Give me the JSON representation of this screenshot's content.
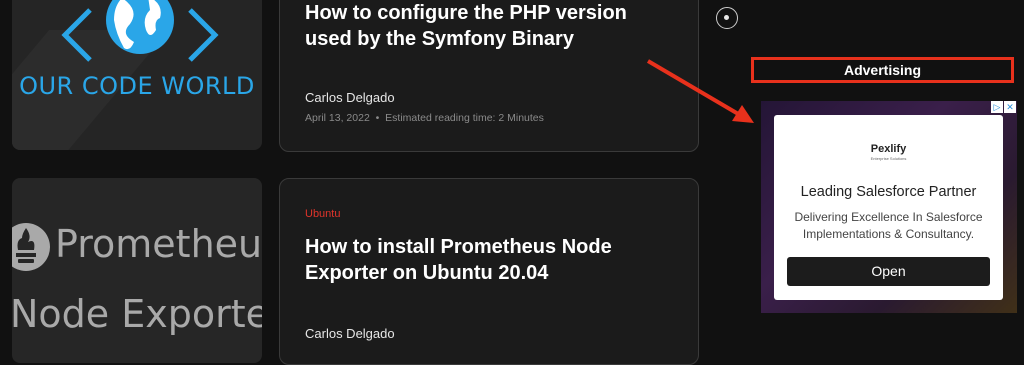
{
  "articles": [
    {
      "logo_text": "OUR CODE WORLD",
      "title_line1": "How to configure the PHP version",
      "title_line2": "used by the Symfony Binary",
      "author": "Carlos Delgado",
      "date": "April 13, 2022",
      "reading_time": "Estimated reading time: 2 Minutes"
    },
    {
      "thumb_line1": "Prometheus",
      "thumb_line2": "Node Exporter",
      "category": "Ubuntu",
      "title_line1": "How to install Prometheus Node",
      "title_line2": "Exporter on Ubuntu 20.04",
      "author": "Carlos Delgado"
    }
  ],
  "sidebar": {
    "advertising_label": "Advertising"
  },
  "ad": {
    "brand": "Pexlify",
    "brand_tagline": "Enterprise Solutions",
    "headline": "Leading Salesforce Partner",
    "body_line1": "Delivering Excellence In Salesforce",
    "body_line2": "Implementations & Consultancy.",
    "cta": "Open",
    "info_glyph": "▷",
    "close_glyph": "✕"
  },
  "colors": {
    "accent_red": "#e8311c",
    "category_red": "#e0342b",
    "logo_blue": "#2aa6e8"
  }
}
